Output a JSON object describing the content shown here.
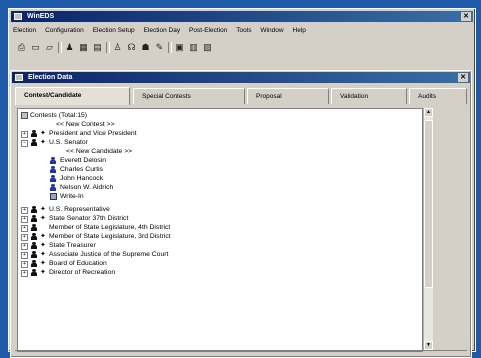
{
  "app": {
    "title": "WinEDS"
  },
  "menu": [
    "Election",
    "Configuration",
    "Election Setup",
    "Election Day",
    "Post-Election",
    "Tools",
    "Window",
    "Help"
  ],
  "child": {
    "title": "Election Data"
  },
  "tabs": [
    "Contest/Candidate",
    "Special Contests",
    "Proposal",
    "Validation",
    "Audits"
  ],
  "tree": {
    "root": "Contests (Total:15)",
    "new_contest": "<< New Contest >>",
    "president": "President and Vice President",
    "senator": "U.S. Senator",
    "new_candidate": "<< New Candidate >>",
    "candidates": [
      "Everett Delosin",
      "Charles Curtis",
      "John Hancock",
      "Nelson W. Aldrich"
    ],
    "write_in": "Write-In",
    "contests": [
      "U.S. Representative",
      "State Senator 37th District",
      "Member of State Legislature, 4th District",
      "Member of State Legislature, 3rd District",
      "State Treasurer",
      "Associate Justice of the Supreme Court",
      "Board of Education",
      "Director of Recreation"
    ]
  }
}
